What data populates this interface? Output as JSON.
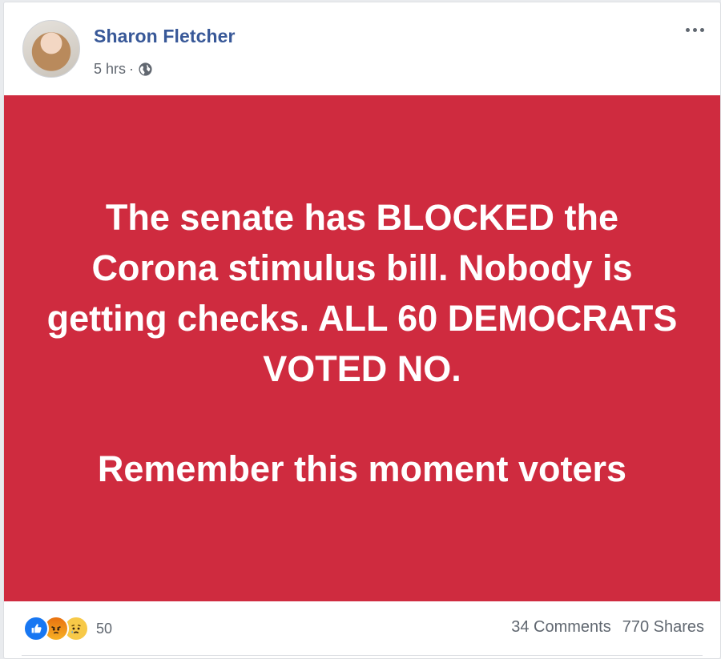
{
  "post": {
    "author": "Sharon Fletcher",
    "time": "5 hrs",
    "separator": "·",
    "privacy_icon": "globe-icon",
    "more_icon": "ellipsis-icon",
    "background_color": "#cf2b3f",
    "text_paragraph_1": "The senate has BLOCKED the Corona stimulus bill. Nobody is getting checks. ALL 60 DEMOCRATS VOTED NO.",
    "text_paragraph_2": "Remember this moment voters"
  },
  "footer": {
    "reactions": [
      "like-icon",
      "angry-icon",
      "sad-icon"
    ],
    "reaction_count": "50",
    "comments": "34 Comments",
    "shares": "770 Shares"
  },
  "colors": {
    "author_link": "#385898",
    "banner": "#cf2b3f",
    "like": "#1877f2"
  }
}
